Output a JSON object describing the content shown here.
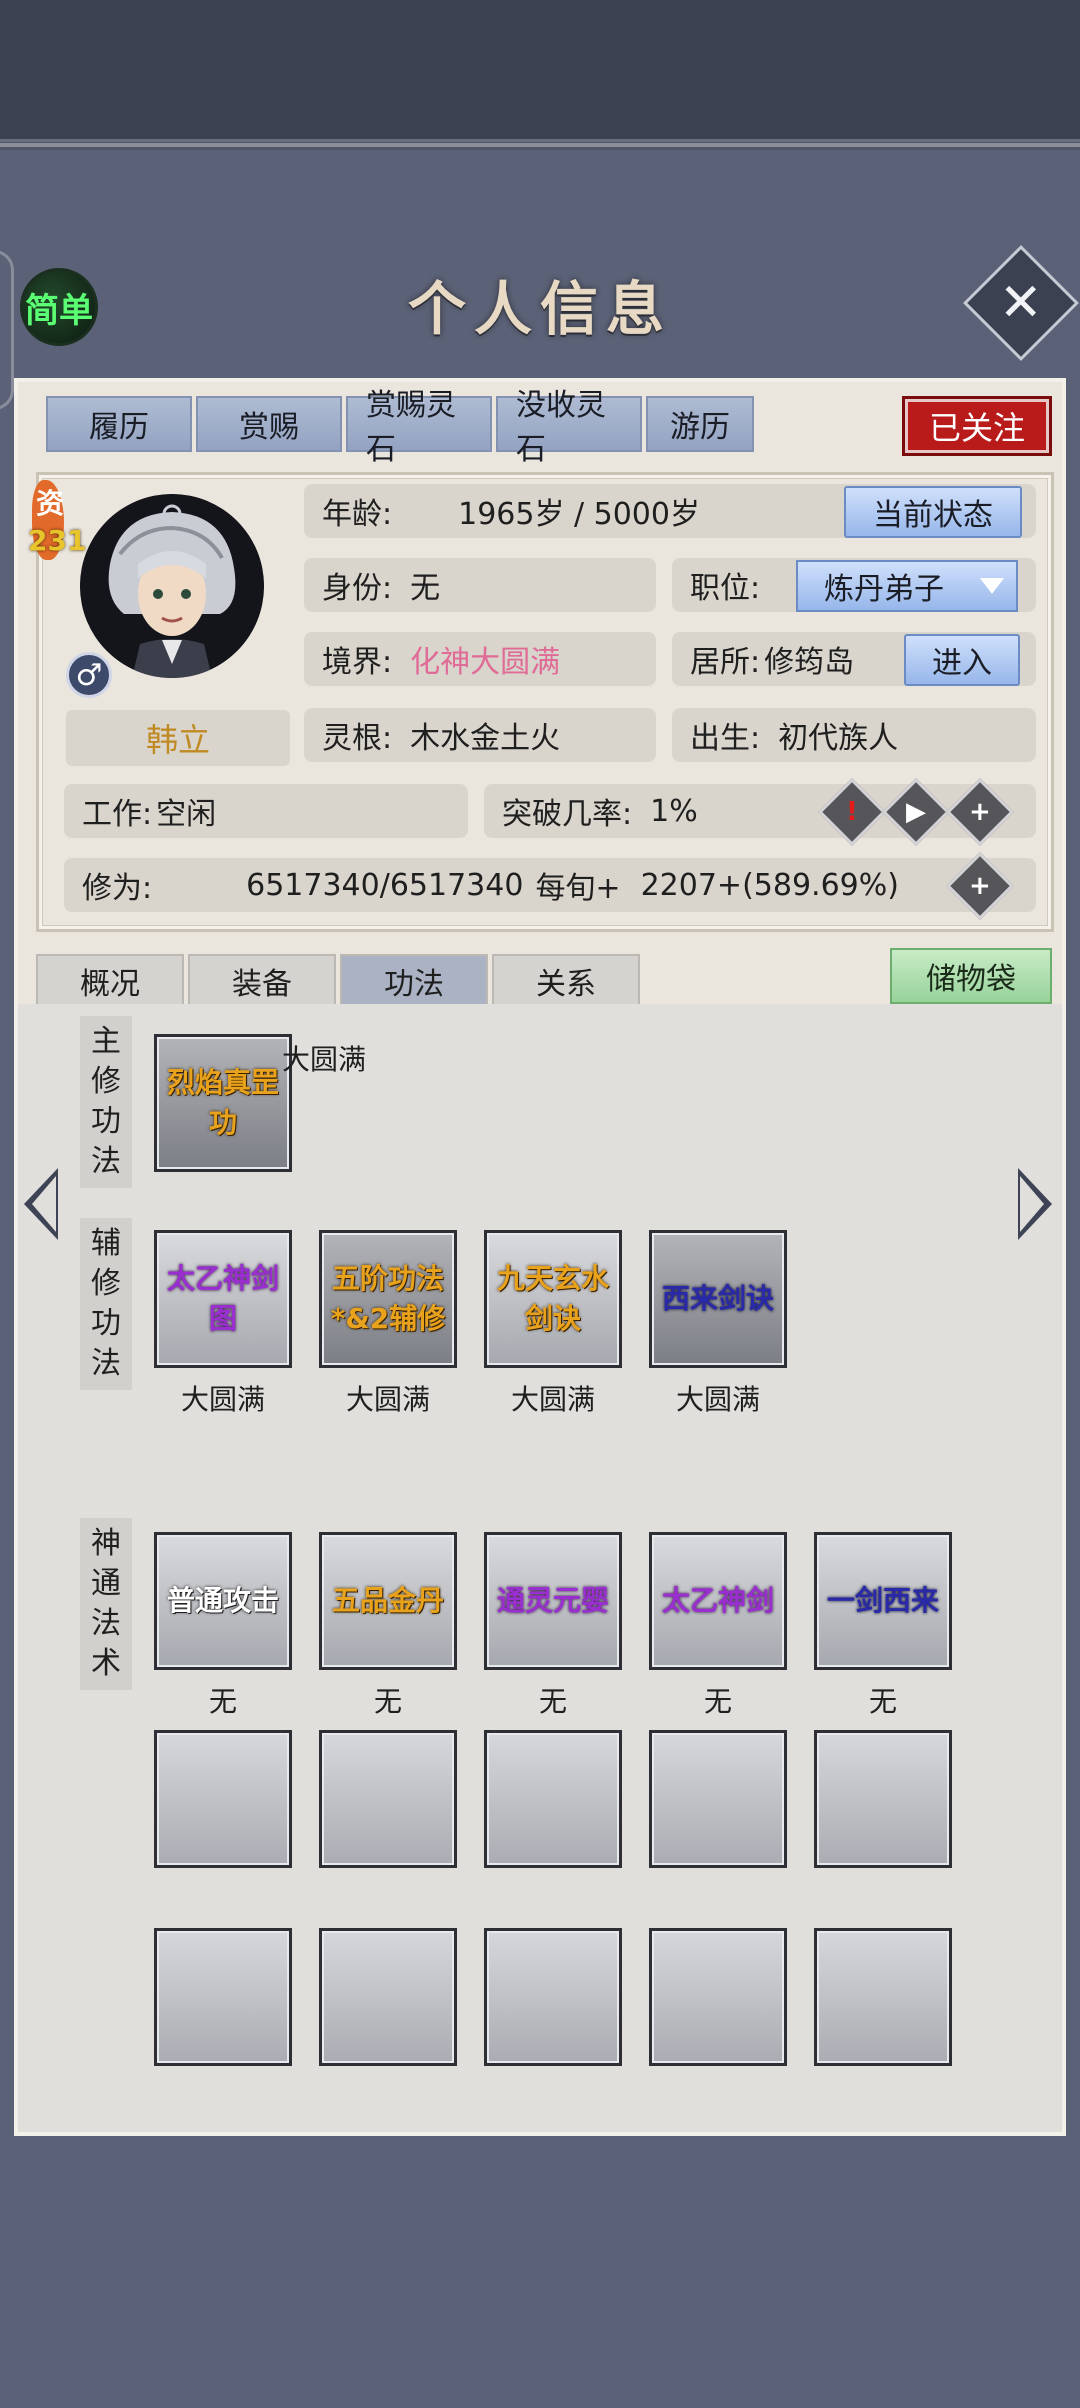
{
  "header": {
    "simple_label": "简单",
    "title": "个人信息",
    "close_icon": "close-icon"
  },
  "top_tabs": [
    "履历",
    "赏赐",
    "赏赐灵石",
    "没收灵石",
    "游历"
  ],
  "follow_label": "已关注",
  "character": {
    "zi_label": "资",
    "zi_value": "231",
    "gender_symbol": "♂",
    "name": "韩立",
    "age_label": "年龄:",
    "age_value": "1965岁 / 5000岁",
    "status_button": "当前状态",
    "identity_label": "身份:",
    "identity_value": "无",
    "position_label": "职位:",
    "position_value": "炼丹弟子",
    "realm_label": "境界:",
    "realm_value": "化神大圆满",
    "residence_label": "居所:",
    "residence_value": "修筠岛",
    "enter_button": "进入",
    "root_label": "灵根:",
    "root_value": "木水金土火",
    "birth_label": "出生:",
    "birth_value": "初代族人",
    "work_label": "工作:",
    "work_value": "空闲",
    "breakthrough_label": "突破几率:",
    "breakthrough_value": "1%",
    "cultivation_label": "修为:",
    "cultivation_value": "6517340/6517340",
    "per_turn_label": "每旬+",
    "per_turn_value": "2207+(589.69%)"
  },
  "mid_tabs": [
    "概况",
    "装备",
    "功法",
    "关系"
  ],
  "active_mid_tab": "功法",
  "bag_label": "储物袋",
  "sections": {
    "main": {
      "label": [
        "主",
        "修",
        "功",
        "法"
      ],
      "skills": [
        {
          "name": "烈焰真罡功",
          "level": "大圆满",
          "color": "gold"
        }
      ]
    },
    "aux": {
      "label": [
        "辅",
        "修",
        "功",
        "法"
      ],
      "skills": [
        {
          "name": "太乙神剑图",
          "level": "大圆满",
          "color": "purple"
        },
        {
          "name": "五阶功法*&2辅修",
          "level": "大圆满",
          "color": "gold"
        },
        {
          "name": "九天玄水剑诀",
          "level": "大圆满",
          "color": "gold"
        },
        {
          "name": "西来剑诀",
          "level": "大圆满",
          "color": "dblue"
        }
      ]
    },
    "magic": {
      "label": [
        "神",
        "通",
        "法",
        "术"
      ],
      "skills": [
        {
          "name": "普通攻击",
          "level": "无",
          "color": "white"
        },
        {
          "name": "五品金丹",
          "level": "无",
          "color": "gold"
        },
        {
          "name": "通灵元婴",
          "level": "无",
          "color": "purple"
        },
        {
          "name": "太乙神剑",
          "level": "无",
          "color": "purple"
        },
        {
          "name": "一剑西来",
          "level": "无",
          "color": "dblue"
        }
      ]
    }
  }
}
